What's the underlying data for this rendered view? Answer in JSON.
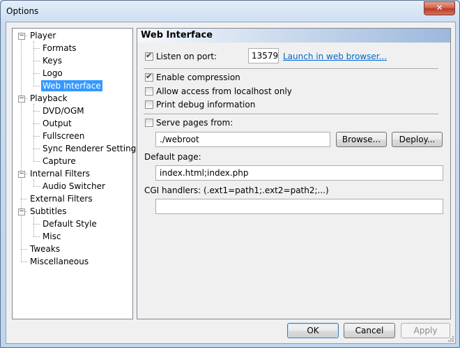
{
  "window": {
    "title": "Options",
    "close_glyph": "✕"
  },
  "tree": [
    {
      "label": "Player",
      "level": 0,
      "expander": "−"
    },
    {
      "label": "Formats",
      "level": 1
    },
    {
      "label": "Keys",
      "level": 1
    },
    {
      "label": "Logo",
      "level": 1
    },
    {
      "label": "Web Interface",
      "level": 1,
      "selected": true
    },
    {
      "label": "Playback",
      "level": 0,
      "expander": "−"
    },
    {
      "label": "DVD/OGM",
      "level": 1
    },
    {
      "label": "Output",
      "level": 1
    },
    {
      "label": "Fullscreen",
      "level": 1
    },
    {
      "label": "Sync Renderer Settings",
      "level": 1
    },
    {
      "label": "Capture",
      "level": 1
    },
    {
      "label": "Internal Filters",
      "level": 0,
      "expander": "−"
    },
    {
      "label": "Audio Switcher",
      "level": 1
    },
    {
      "label": "External Filters",
      "level": 0
    },
    {
      "label": "Subtitles",
      "level": 0,
      "expander": "−"
    },
    {
      "label": "Default Style",
      "level": 1
    },
    {
      "label": "Misc",
      "level": 1
    },
    {
      "label": "Tweaks",
      "level": 0
    },
    {
      "label": "Miscellaneous",
      "level": 0
    }
  ],
  "panel": {
    "header": "Web Interface",
    "listen_label": "Listen on port:",
    "listen_checked": true,
    "port_value": "13579",
    "launch_link": "Launch in web browser...",
    "enable_compression": {
      "label": "Enable compression",
      "checked": true
    },
    "allow_localhost": {
      "label": "Allow access from localhost only",
      "checked": false
    },
    "print_debug": {
      "label": "Print debug information",
      "checked": false
    },
    "serve_pages": {
      "label": "Serve pages from:",
      "checked": false
    },
    "webroot_value": "./webroot",
    "browse_label": "Browse...",
    "deploy_label": "Deploy...",
    "default_page_label": "Default page:",
    "default_page_value": "index.html;index.php",
    "cgi_label": "CGI handlers: (.ext1=path1;.ext2=path2;...)",
    "cgi_value": ""
  },
  "footer": {
    "ok": "OK",
    "cancel": "Cancel",
    "apply": "Apply"
  },
  "colors": {
    "selection": "#3399ff",
    "link": "#0066cc"
  }
}
